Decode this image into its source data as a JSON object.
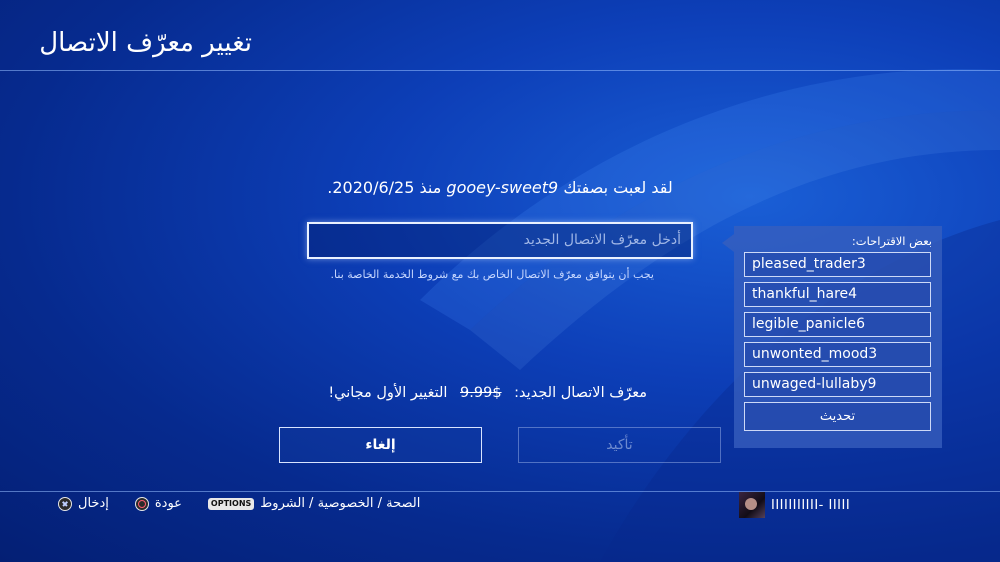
{
  "header": {
    "title": "تغيير معرّف الاتصال"
  },
  "played_as": {
    "prefix": "لقد لعبت بصفتك",
    "old_id": "gooey-sweet9",
    "since_label": "منذ",
    "date": "2020/6/25."
  },
  "new_id_input": {
    "value": "",
    "placeholder": "أدخل معرّف الاتصال الجديد"
  },
  "agreement_note": "يجب أن يتوافق معرّف الاتصال الخاص بك مع شروط الخدمة الخاصة بنا.",
  "price_line": {
    "label": "معرّف الاتصال الجديد:",
    "old_price": "$9.99",
    "free_note": "التغيير الأول مجاني!"
  },
  "buttons": {
    "confirm": "تأكيد",
    "cancel": "إلغاء"
  },
  "suggestions": {
    "title": "بعض الاقتراحات:",
    "items": [
      "pleased_trader3",
      "thankful_hare4",
      "legible_panicle6",
      "unwonted_mood3",
      "unwaged-lullaby9"
    ],
    "refresh": "تحديث"
  },
  "footer": {
    "enter": "إدخال",
    "back": "عودة",
    "options_badge": "OPTIONS",
    "links": "الصحة / الخصوصية / الشروط",
    "username": "IIIIIIIIIII- IIIII"
  }
}
